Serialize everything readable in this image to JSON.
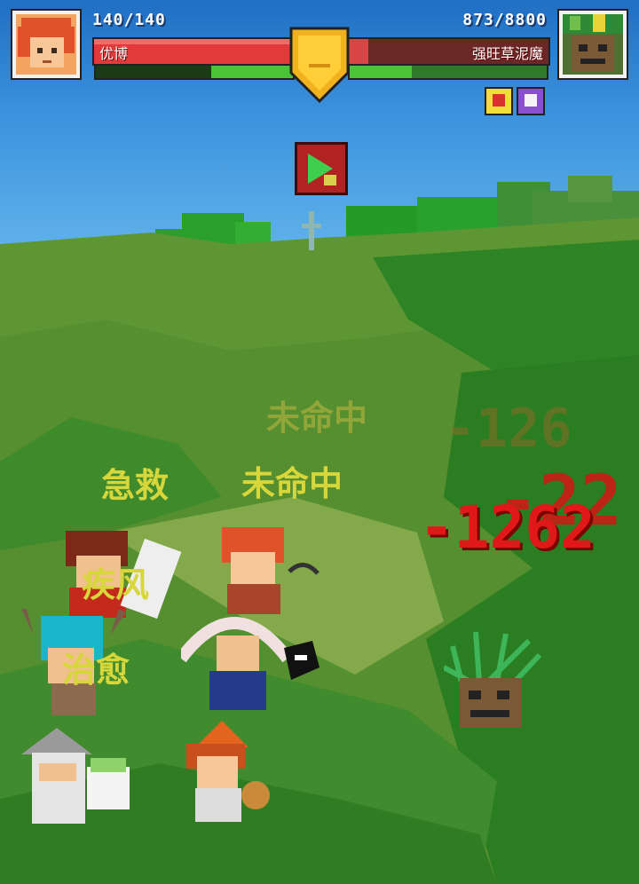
{
  "hud": {
    "player_hp_text": "140/140",
    "player_name": "优博",
    "enemy_hp_text": "873/8800",
    "enemy_name": "强旺草泥魔"
  },
  "floating_texts": {
    "miss_1": "未命中",
    "miss_2": "未命中",
    "first_aid": "急救",
    "gale": "疾风",
    "heal": "治愈"
  },
  "damage_numbers": {
    "faded": "-126",
    "big_overlay": "-22",
    "main": "-1262"
  },
  "colors": {
    "player_hp": "#e23a3a",
    "enemy_hp_remaining": "#d94545",
    "stamina": "#4cc437",
    "skill_text": "#d7d63a",
    "damage": "#e01818"
  },
  "icons": {
    "player_portrait": "red-haired-hero-portrait",
    "enemy_portrait": "grass-golem-portrait",
    "center_shield": "gold-shield-icon",
    "speed_button": "fast-forward-icon",
    "debuff_1": "red-shield-debuff-icon",
    "debuff_2": "purple-skull-debuff-icon"
  }
}
